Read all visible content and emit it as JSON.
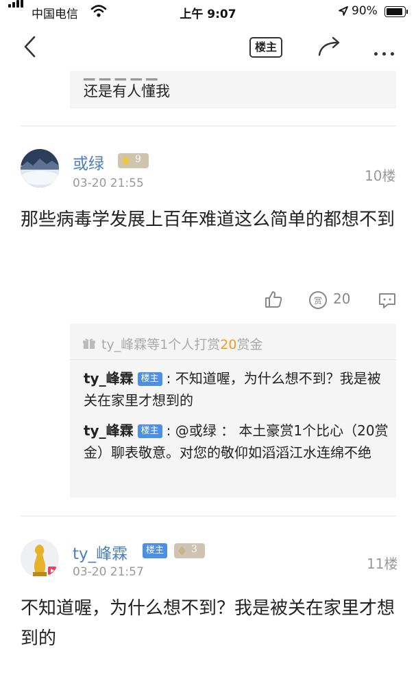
{
  "status_bar": {
    "carrier": "中国电信",
    "time": "上午 9:07",
    "battery": "90%",
    "battery_level": 0.9
  },
  "nav": {
    "owner_only_label": "楼主"
  },
  "top_quote": {
    "text": "还是有人懂我"
  },
  "posts": [
    {
      "username": "或绿",
      "level": "9",
      "timestamp": "03-20 21:55",
      "floor": "10楼",
      "content": "那些病毒学发展上百年难道这么简单的都想不到",
      "reward_count": "20",
      "reward_summary": {
        "prefix": "ty_峰霖等1个人打赏",
        "amount": "20",
        "suffix": "赏金"
      },
      "replies": [
        {
          "who": "ty_峰霖",
          "tag": "楼主",
          "text": ": 不知道喔，为什么想不到？我是被关在家里才想到的"
        },
        {
          "who": "ty_峰霖",
          "tag": "楼主",
          "text": ": @或绿 ： 本土豪赏1个比心（20赏金）聊表敬意。对您的敬仰如滔滔江水连绵不绝"
        }
      ]
    },
    {
      "username": "ty_峰霖",
      "owner_tag": "楼主",
      "level": "3",
      "timestamp": "03-20 21:57",
      "floor": "11楼",
      "content": "不知道喔，为什么想不到？我是被关在家里才想到的"
    }
  ]
}
